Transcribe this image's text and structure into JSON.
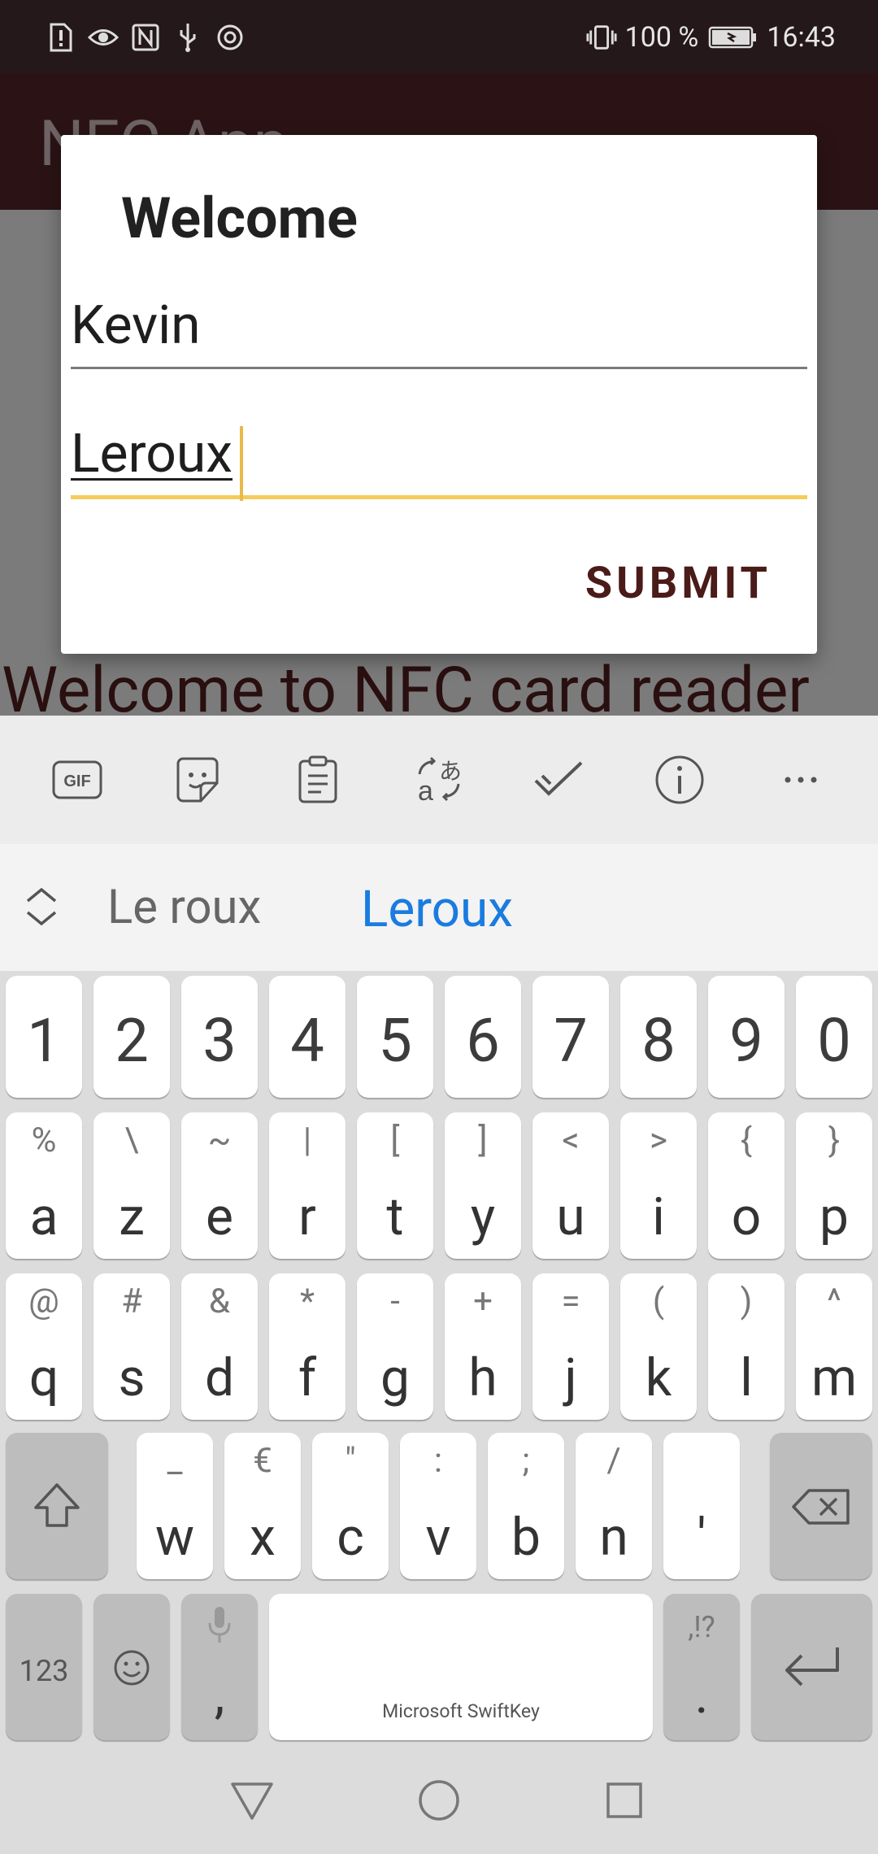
{
  "status_bar": {
    "battery_percent": "100 %",
    "time": "16:43",
    "icons": [
      "alert-icon",
      "eye-icon",
      "nfc-icon",
      "usb-icon",
      "chrome-icon",
      "vibrate-icon",
      "battery-charging-icon"
    ]
  },
  "app": {
    "title": "NFC App",
    "welcome_text": "Welcome to NFC card reader"
  },
  "dialog": {
    "title": "Welcome",
    "first_name_value": "Kevin",
    "last_name_value": "Leroux",
    "submit_label": "SUBMIT",
    "accent_color": "#f5cb5c"
  },
  "keyboard": {
    "toolbar_icons": [
      "gif-icon",
      "sticker-icon",
      "clipboard-icon",
      "translate-icon",
      "check-icon",
      "info-icon",
      "more-icon"
    ],
    "suggestions": [
      "Le roux",
      "Leroux"
    ],
    "rows": {
      "numbers": [
        "1",
        "2",
        "3",
        "4",
        "5",
        "6",
        "7",
        "8",
        "9",
        "0"
      ],
      "row1": [
        {
          "main": "a",
          "sub": "%"
        },
        {
          "main": "z",
          "sub": "\\"
        },
        {
          "main": "e",
          "sub": "~"
        },
        {
          "main": "r",
          "sub": "|"
        },
        {
          "main": "t",
          "sub": "["
        },
        {
          "main": "y",
          "sub": "]"
        },
        {
          "main": "u",
          "sub": "<"
        },
        {
          "main": "i",
          "sub": ">"
        },
        {
          "main": "o",
          "sub": "{"
        },
        {
          "main": "p",
          "sub": "}"
        }
      ],
      "row2": [
        {
          "main": "q",
          "sub": "@"
        },
        {
          "main": "s",
          "sub": "#"
        },
        {
          "main": "d",
          "sub": "&"
        },
        {
          "main": "f",
          "sub": "*"
        },
        {
          "main": "g",
          "sub": "-"
        },
        {
          "main": "h",
          "sub": "+"
        },
        {
          "main": "j",
          "sub": "="
        },
        {
          "main": "k",
          "sub": "("
        },
        {
          "main": "l",
          "sub": ")"
        },
        {
          "main": "m",
          "sub": "^"
        }
      ],
      "row3": [
        {
          "main": "w",
          "sub": "_"
        },
        {
          "main": "x",
          "sub": "€"
        },
        {
          "main": "c",
          "sub": "\""
        },
        {
          "main": "v",
          "sub": ":"
        },
        {
          "main": "b",
          "sub": ";"
        },
        {
          "main": "n",
          "sub": "/"
        },
        {
          "main": "'",
          "sub": ""
        }
      ]
    },
    "numbers_label": "123",
    "comma_label": ",",
    "space_label": "Microsoft SwiftKey",
    "period_label": ".",
    "period_sub": ",!?"
  }
}
